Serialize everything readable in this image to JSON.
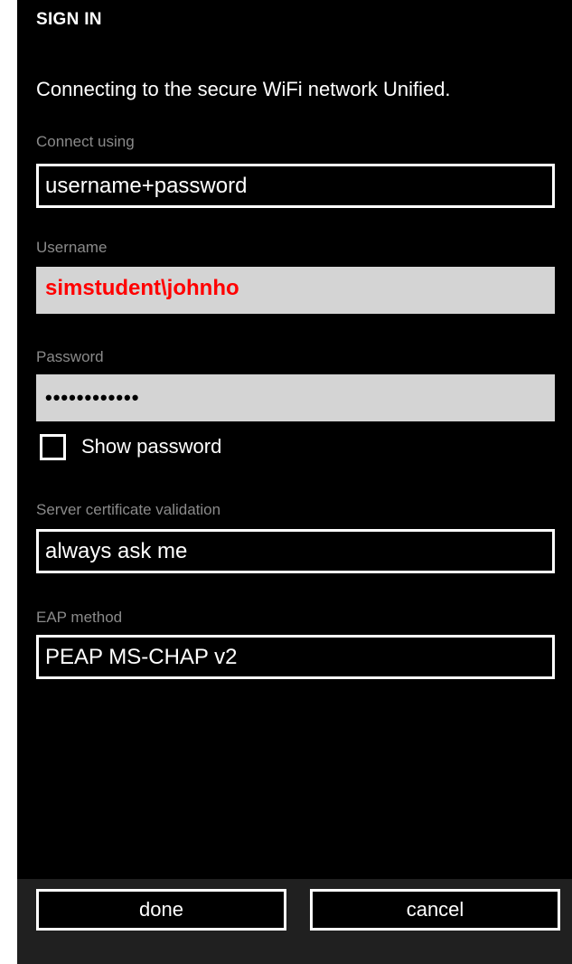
{
  "header": {
    "title": "SIGN IN",
    "intro": "Connecting to the secure WiFi network Unified."
  },
  "form": {
    "connect_using": {
      "label": "Connect using",
      "value": "username+password"
    },
    "username": {
      "label": "Username",
      "value": "simstudent\\johnho"
    },
    "password": {
      "label": "Password",
      "value": "••••••••••••"
    },
    "show_password": {
      "label": "Show password",
      "checked": false
    },
    "server_cert_validation": {
      "label": "Server certificate validation",
      "value": "always ask me"
    },
    "eap_method": {
      "label": "EAP method",
      "value": "PEAP MS-CHAP v2"
    }
  },
  "appbar": {
    "done_label": "done",
    "cancel_label": "cancel"
  },
  "colors": {
    "background": "#000000",
    "input_fill": "#d4d4d4",
    "highlight_text": "#ff0000",
    "label_gray": "#8a8a8a",
    "appbar": "#202020"
  }
}
